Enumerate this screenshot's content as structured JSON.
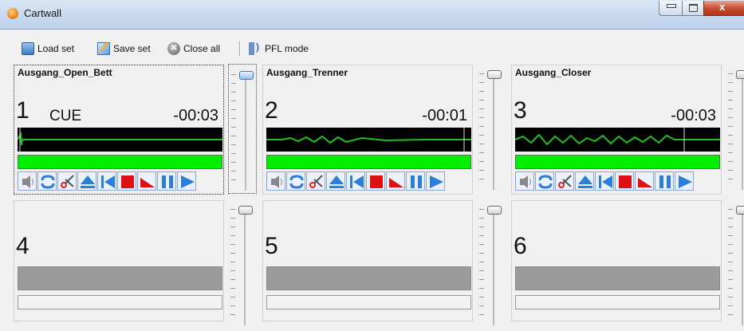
{
  "window": {
    "title": "Cartwall",
    "controls": {
      "minimize": "minimize",
      "maximize": "maximize",
      "close": "x"
    }
  },
  "toolbar": {
    "load_set": "Load set",
    "save_set": "Save set",
    "close_all": "Close all",
    "pfl_mode": "PFL mode"
  },
  "carts": [
    {
      "number": "1",
      "name": "Ausgang_Open_Bett",
      "status": "CUE",
      "time": "-00:03",
      "loaded": true,
      "progress": 1.0,
      "selected": true,
      "fader_active": true
    },
    {
      "number": "2",
      "name": "Ausgang_Trenner",
      "status": "",
      "time": "-00:01",
      "loaded": true,
      "progress": 1.0,
      "selected": false,
      "fader_active": false
    },
    {
      "number": "3",
      "name": "Ausgang_Closer",
      "status": "",
      "time": "-00:03",
      "loaded": true,
      "progress": 1.0,
      "selected": false,
      "fader_active": false
    },
    {
      "number": "4",
      "name": "",
      "status": "",
      "time": "",
      "loaded": false
    },
    {
      "number": "5",
      "name": "",
      "status": "",
      "time": "",
      "loaded": false
    },
    {
      "number": "6",
      "name": "",
      "status": "",
      "time": "",
      "loaded": false
    }
  ],
  "cart_buttons": [
    "speaker-icon",
    "loop-icon",
    "scissors-icon",
    "eject-icon",
    "skip-start-icon",
    "stop-icon",
    "fade-out-icon",
    "pause-icon",
    "play-icon"
  ],
  "colors": {
    "level_green": "#00ee00",
    "waveform": "#1fbf1f",
    "stop_red": "#dd1111",
    "control_blue": "#2a7fdc"
  }
}
